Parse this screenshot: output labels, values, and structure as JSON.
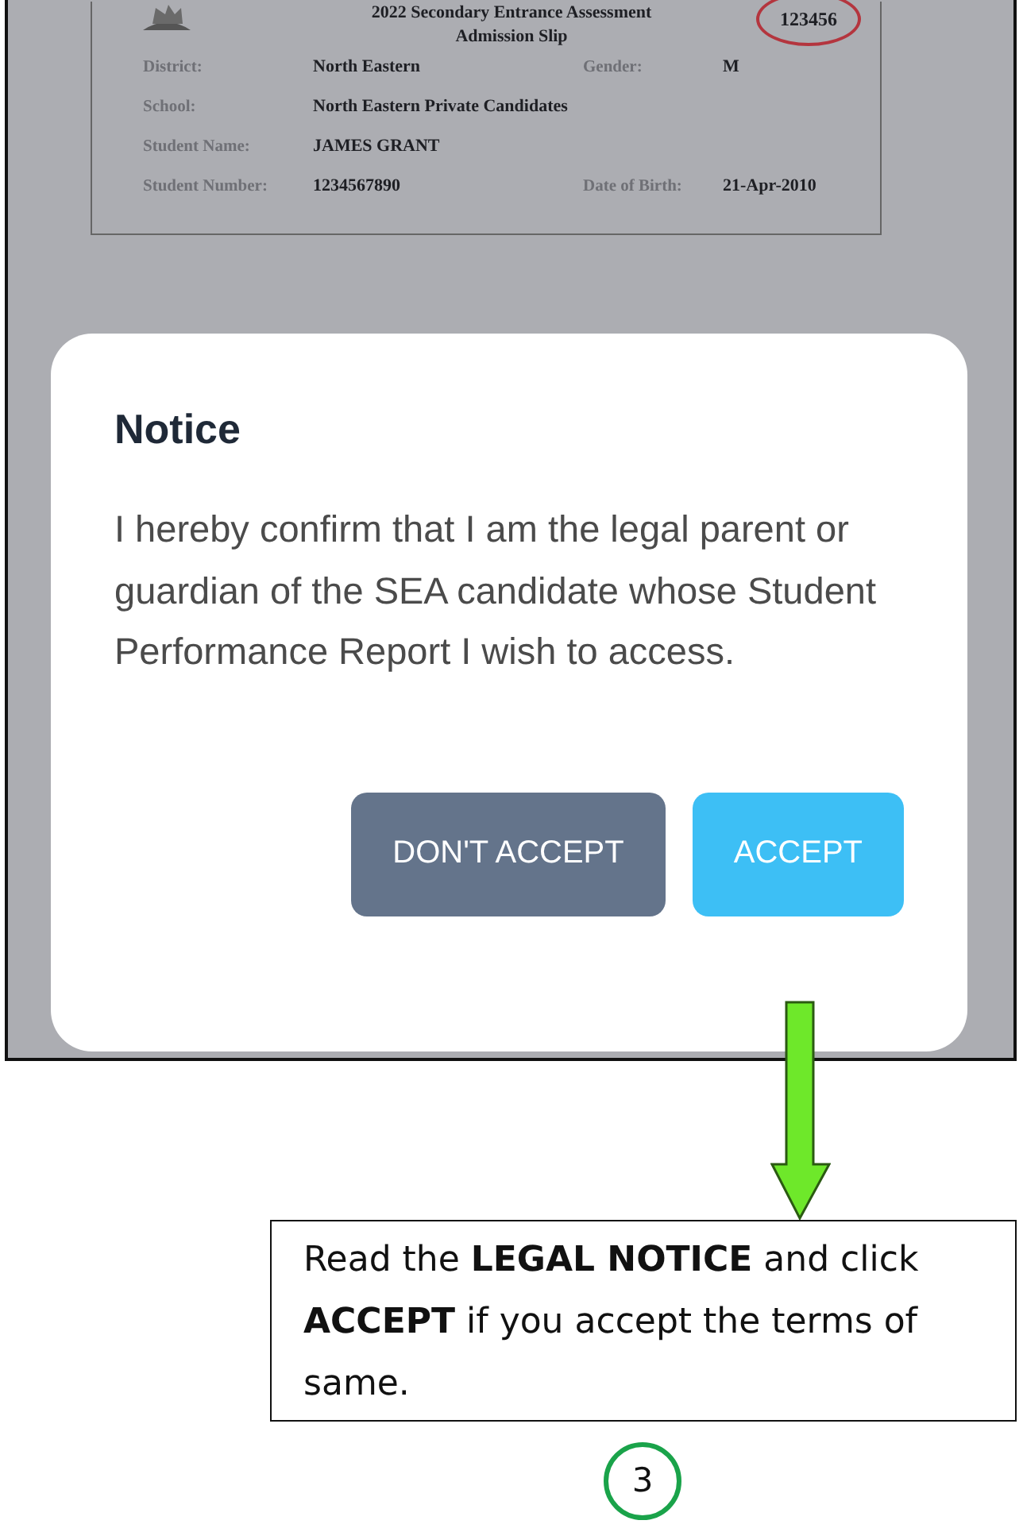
{
  "admission_slip": {
    "heading": "2022 Secondary Entrance Assessment",
    "subheading": "Admission Slip",
    "number": "123456",
    "fields": [
      {
        "label": "District:",
        "value": "North Eastern",
        "label_2": "Gender:",
        "value_2": "M"
      },
      {
        "label": "School:",
        "value": "North Eastern Private Candidates"
      },
      {
        "label": "Student Name:",
        "value": "JAMES  GRANT"
      },
      {
        "label": "Student Number:",
        "value": "1234567890",
        "label_2": "Date of Birth:",
        "value_2": "21-Apr-2010"
      }
    ]
  },
  "dialog": {
    "title": "Notice",
    "message": "I hereby confirm that I am the legal parent or guardian of the SEA candidate whose Student Performance Report I wish to access.",
    "buttons": [
      {
        "label": "DON'T ACCEPT",
        "kind": "secondary"
      },
      {
        "label": "ACCEPT",
        "kind": "primary"
      }
    ]
  },
  "callout": {
    "text": "Read the **LEGAL NOTICE** and click **ACCEPT** if you accept the terms of same."
  },
  "step_number": "3"
}
